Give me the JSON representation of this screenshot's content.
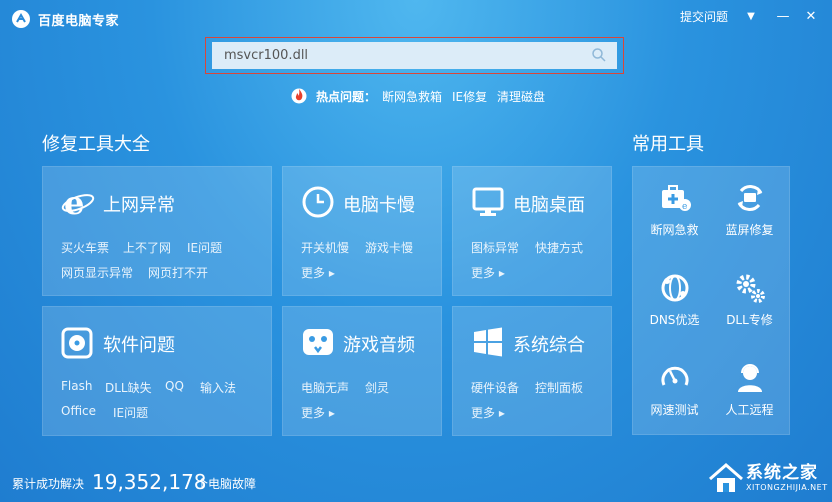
{
  "app": {
    "title": "百度电脑专家"
  },
  "titlebar": {
    "feedback": "提交问题",
    "dropdown_glyph": "▼",
    "minimize_glyph": "—",
    "close_glyph": "✕"
  },
  "search": {
    "value": "msvcr100.dll",
    "placeholder": ""
  },
  "hot": {
    "label": "热点问题：",
    "links": [
      "断网急救箱",
      "IE修复",
      "清理磁盘"
    ]
  },
  "sections": {
    "repair_title": "修复工具大全",
    "common_title": "常用工具"
  },
  "cards": [
    {
      "title": "上网异常",
      "links": [
        "买火车票",
        "上不了网",
        "IE问题",
        "网页显示异常",
        "网页打不开"
      ],
      "more": ""
    },
    {
      "title": "电脑卡慢",
      "links": [
        "开关机慢",
        "游戏卡慢"
      ],
      "more": "更多 ▸"
    },
    {
      "title": "电脑桌面",
      "links": [
        "图标异常",
        "快捷方式"
      ],
      "more": "更多 ▸"
    },
    {
      "title": "软件问题",
      "links": [
        "Flash",
        "DLL缺失",
        "QQ",
        "输入法",
        "Office",
        "IE问题"
      ],
      "more": ""
    },
    {
      "title": "游戏音频",
      "links": [
        "电脑无声",
        "剑灵"
      ],
      "more": "更多 ▸"
    },
    {
      "title": "系统综合",
      "links": [
        "硬件设备",
        "控制面板"
      ],
      "more": "更多 ▸"
    }
  ],
  "tools": [
    "断网急救",
    "蓝屏修复",
    "DNS优选",
    "DLL专修",
    "网速测试",
    "人工远程"
  ],
  "footer": {
    "label": "累计成功解决",
    "count": "19,352,178",
    "suffix": "个电脑故障"
  },
  "watermark": {
    "title": "系统之家",
    "url": "XITONGZHIJIA.NET"
  },
  "colors": {
    "bg_top": "#4fb7ef",
    "bg_bottom": "#1f7dd0",
    "hot_red": "#e8402c",
    "search_border": "#d9463a"
  }
}
